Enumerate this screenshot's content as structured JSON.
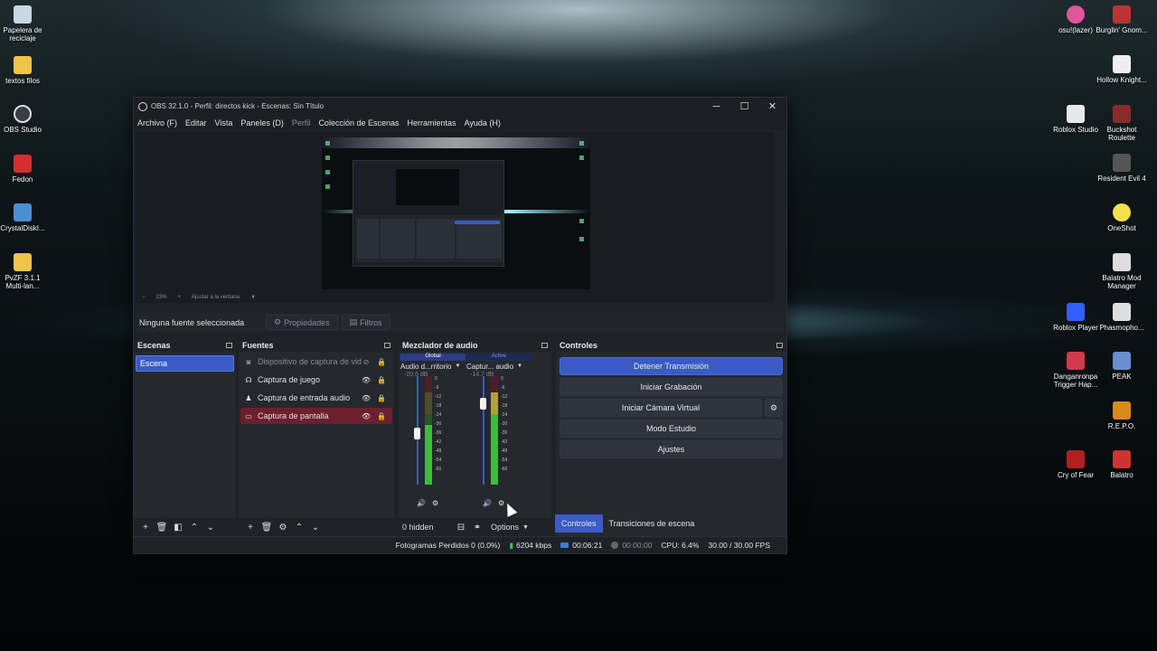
{
  "desktop_left": [
    {
      "label": "Papelera de reciclaje",
      "icon": "recycle-bin-icon",
      "color": "#c9d6e3"
    },
    {
      "label": "textos filos",
      "icon": "folder-icon",
      "color": "#f0c44a"
    },
    {
      "label": "OBS Studio",
      "icon": "obs-icon",
      "color": "#3a3d44"
    },
    {
      "label": "Fedon",
      "icon": "pdf-icon",
      "color": "#d42e2e"
    },
    {
      "label": "CrystalDiskI...",
      "icon": "crystaldisk-icon",
      "color": "#4a8fd4"
    },
    {
      "label": "PvZF 3.1.1 Multi-lan...",
      "icon": "folder-icon",
      "color": "#f0c44a"
    }
  ],
  "desktop_right": [
    {
      "label": "osu!(lazer)",
      "icon": "osu-icon",
      "color": "#e0559b"
    },
    {
      "label": "Roblox Studio",
      "icon": "roblox-studio-icon",
      "color": "#e8e8e8"
    },
    {
      "label": "Roblox Player",
      "icon": "roblox-player-icon",
      "color": "#335fff"
    },
    {
      "label": "Danganronpa Trigger Hap...",
      "icon": "danganronpa-icon",
      "color": "#d03a4a"
    },
    {
      "label": "Cry of Fear",
      "icon": "cry-of-fear-icon",
      "color": "#b02020"
    },
    {
      "label": "Burglin' Gnom...",
      "icon": "burglin-gnomes-icon",
      "color": "#b33"
    },
    {
      "label": "Hollow Knight...",
      "icon": "hollow-knight-icon",
      "color": "#eeeeee"
    },
    {
      "label": "Buckshot Roulette",
      "icon": "buckshot-icon",
      "color": "#8a2a2a"
    },
    {
      "label": "Resident Evil 4",
      "icon": "resident-evil-icon",
      "color": "#555555"
    },
    {
      "label": "OneShot",
      "icon": "oneshot-icon",
      "color": "#f4e04a"
    },
    {
      "label": "Balatro Mod Manager",
      "icon": "balatro-mm-icon",
      "color": "#dddddd"
    },
    {
      "label": "Phasmopho...",
      "icon": "phasmophobia-icon",
      "color": "#dddddd"
    },
    {
      "label": "PEAK",
      "icon": "peak-icon",
      "color": "#6a8fd0"
    },
    {
      "label": "R.E.P.O.",
      "icon": "repo-icon",
      "color": "#d88a1a"
    },
    {
      "label": "Balatro",
      "icon": "balatro-icon",
      "color": "#c33"
    }
  ],
  "window": {
    "title": "OBS 32.1.0 - Perfil: directos kick - Escenas: Sin Título",
    "minimize": "─",
    "maximize": "☐",
    "close": "✕"
  },
  "menu": [
    "Archivo (F)",
    "Editar",
    "Vista",
    "Paneles (D)",
    "Perfil",
    "Colección de Escenas",
    "Herramientas",
    "Ayuda (H)"
  ],
  "zoombar": {
    "minus": "−",
    "zoom": "23%",
    "plus": "+",
    "fit": "Ajustar a la ventana"
  },
  "sourcebar": {
    "no_selection": "Ninguna fuente seleccionada",
    "properties": "Propiedades",
    "filters": "Filtros"
  },
  "scenes": {
    "title": "Escenas",
    "items": [
      "Escena"
    ]
  },
  "sources": {
    "title": "Fuentes",
    "items": [
      {
        "label": "Dispositivo de captura de video",
        "icon": "◙"
      },
      {
        "label": "Captura de juego",
        "icon": "☊"
      },
      {
        "label": "Captura de entrada audio",
        "icon": "♟"
      },
      {
        "label": "Captura de pantalla",
        "icon": "▭"
      }
    ]
  },
  "mixer": {
    "title": "Mezclador de audio",
    "channels": [
      {
        "tag": "Global",
        "name": "Audio d...rritorio",
        "db": "-20.6 dB",
        "level": 0.55
      },
      {
        "tag": "Active",
        "name": "Captur... audio",
        "db": "-14.7 dB",
        "level": 0.85
      }
    ],
    "scale": [
      "0",
      "-6",
      "-12",
      "-18",
      "-24",
      "-30",
      "-36",
      "-42",
      "-48",
      "-54",
      "-60"
    ],
    "hidden": "0 hidden",
    "options": "Options"
  },
  "controls": {
    "title": "Controles",
    "stop_stream": "Detener Transmisión",
    "start_record": "Iniciar Grabación",
    "start_vcam": "Iniciar Cámara Virtual",
    "studio_mode": "Modo Estudio",
    "settings": "Ajustes"
  },
  "tabs": [
    "Controles",
    "Transiciones de escena"
  ],
  "status": {
    "dropped": "Fotogramas Perdidos 0 (0.0%)",
    "bitrate": "6204 kbps",
    "stream_time": "00:06:21",
    "record_time": "00:00:00",
    "cpu": "CPU: 6.4%",
    "fps": "30.00 / 30.00 FPS"
  }
}
